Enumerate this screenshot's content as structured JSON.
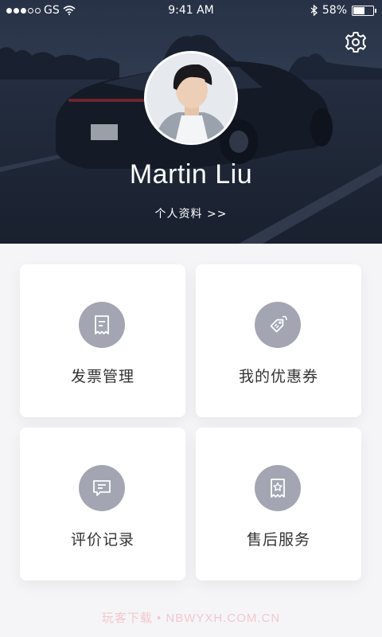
{
  "status_bar": {
    "carrier": "GS",
    "time": "9:41 AM",
    "battery_percent": "58%",
    "battery_level": 0.58,
    "signal_bars_filled": 3,
    "signal_bars_total": 5
  },
  "header": {
    "user_name": "Martin Liu",
    "profile_link": "个人资料 >>",
    "settings_icon": "gear-icon"
  },
  "menu": [
    {
      "label": "发票管理",
      "icon": "invoice-icon"
    },
    {
      "label": "我的优惠券",
      "icon": "coupon-tag-icon"
    },
    {
      "label": "评价记录",
      "icon": "comment-icon"
    },
    {
      "label": "售后服务",
      "icon": "after-sales-star-icon"
    }
  ],
  "watermark": "玩客下载 • NBWYXH.COM.CN",
  "colors": {
    "icon_circle": "#a3a6b2",
    "background": "#f5f5f7",
    "header_dark": "#222c3d"
  }
}
